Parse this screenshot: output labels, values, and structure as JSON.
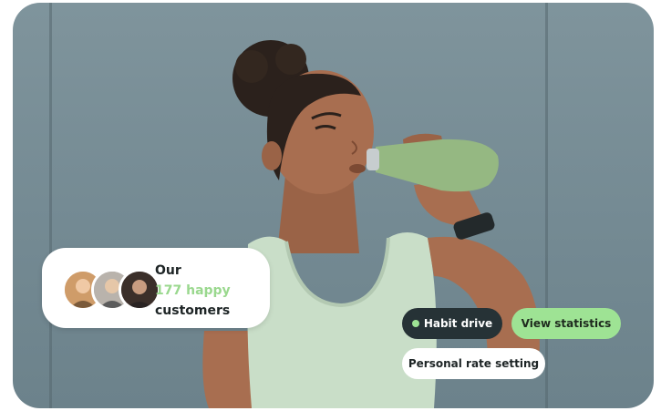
{
  "badge": {
    "line1": "Our",
    "line2": "177 happy",
    "line3": "customers"
  },
  "tags": {
    "habit_drive": "Habit drive",
    "view_statistics": "View statistics",
    "personal_rate_setting": "Personal rate setting"
  },
  "colors": {
    "accent_green": "#9ee394",
    "dark_pill": "#263236",
    "backdrop": "#7a8f97"
  }
}
